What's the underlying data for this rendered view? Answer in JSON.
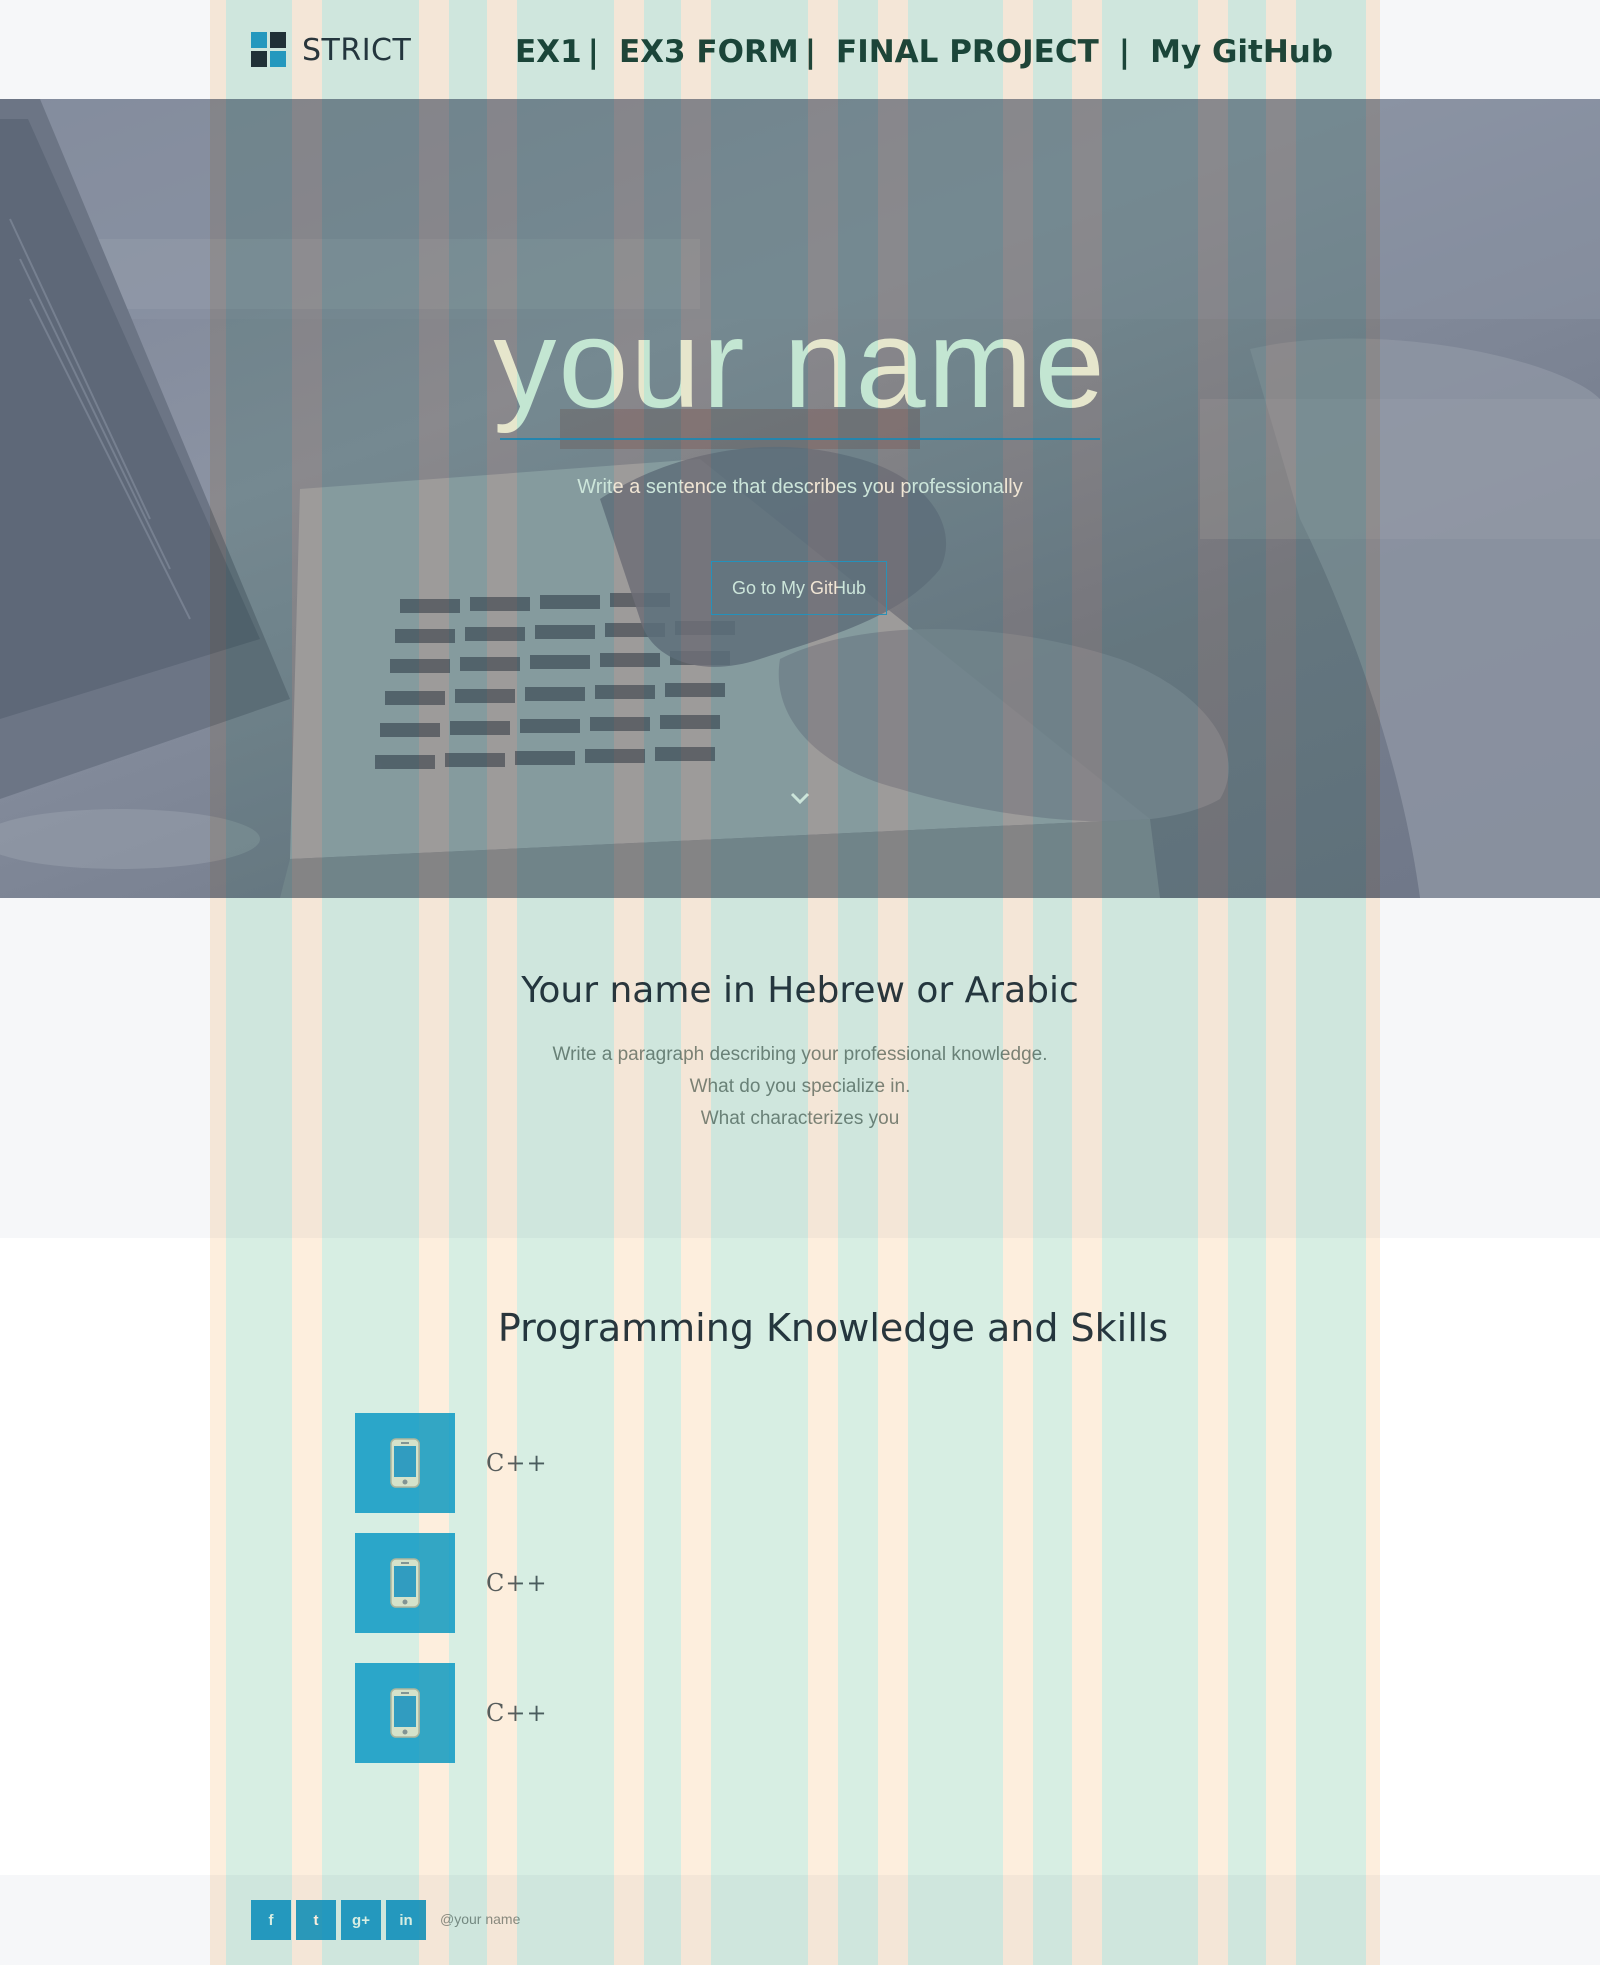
{
  "header": {
    "brand": "STRICT",
    "nav": [
      {
        "label": "EX1",
        "separator": "|"
      },
      {
        "label": "EX3 FORM",
        "separator": "|"
      },
      {
        "label": "FINAL PROJECT",
        "separator": "|"
      },
      {
        "label": "My GitHub",
        "separator": ""
      }
    ]
  },
  "hero": {
    "title": "your name",
    "subtitle": "Write a sentence that describes you professionally",
    "button_label": "Go to My GitHub",
    "scroll_icon": "chevron-down-icon"
  },
  "about": {
    "title": "Your name in Hebrew or Arabic",
    "lines": [
      "Write a paragraph describing your professional knowledge.",
      "What do you specialize in.",
      "What characterizes you"
    ]
  },
  "skills": {
    "title": "Programming Knowledge and Skills",
    "items": [
      {
        "icon": "smartphone-icon",
        "label": "C++"
      },
      {
        "icon": "smartphone-icon",
        "label": "C++"
      },
      {
        "icon": "smartphone-icon",
        "label": "C++"
      }
    ]
  },
  "footer": {
    "social": [
      {
        "icon": "facebook-icon",
        "glyph": "f"
      },
      {
        "icon": "twitter-icon",
        "glyph": "t"
      },
      {
        "icon": "google-plus-icon",
        "glyph": "g+"
      },
      {
        "icon": "linkedin-icon",
        "glyph": "in"
      }
    ],
    "credit": "@your name"
  },
  "colors": {
    "accent": "#2aa3d6",
    "skill_icon_bg": "#33b2e2",
    "nav_text": "#1f4a40",
    "grid_teal": "#cfeadd",
    "grid_peach": "#fde9d3"
  }
}
